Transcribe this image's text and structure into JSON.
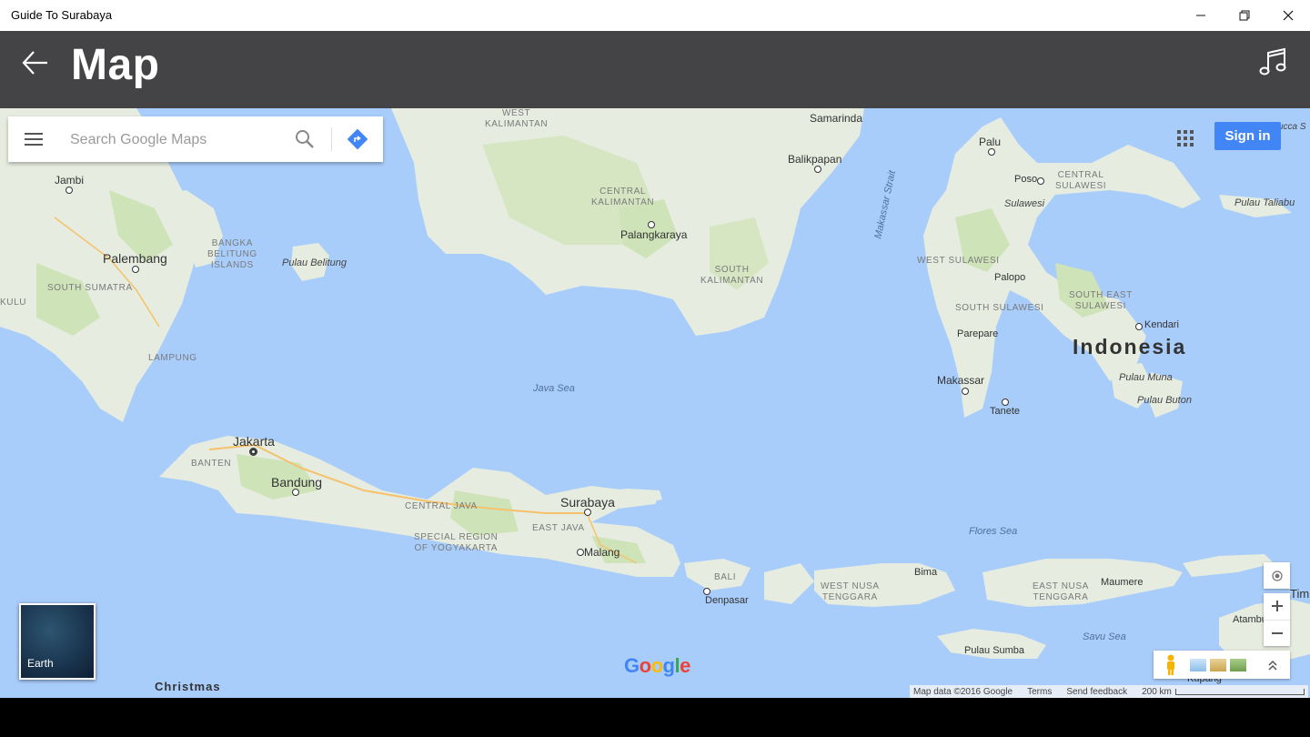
{
  "window": {
    "title": "Guide To Surabaya"
  },
  "header": {
    "title": "Map"
  },
  "search": {
    "placeholder": "Search Google Maps"
  },
  "signin": {
    "label": "Sign in"
  },
  "earth": {
    "label": "Earth"
  },
  "attribution": {
    "map_data": "Map data ©2016 Google",
    "terms": "Terms",
    "feedback": "Send feedback",
    "scale": "200 km"
  },
  "logo": {
    "text": "Google"
  },
  "labels": {
    "samarinda": "Samarinda",
    "balikpapan": "Balikpapan",
    "west_kalimantan": "WEST\nKALIMANTAN",
    "central_kalimantan": "CENTRAL\nKALIMANTAN",
    "palangkaraya": "Palangkaraya",
    "south_kalimantan": "SOUTH\nKALIMANTAN",
    "makassar_strait": "Makassar Strait",
    "palu": "Palu",
    "poso": "Poso",
    "central_sulawesi": "CENTRAL\nSULAWESI",
    "sulawesi": "Sulawesi",
    "pulau_taliabu": "Pulau Taliabu",
    "west_sulawesi": "WEST SULAWESI",
    "palopo": "Palopo",
    "south_east_sulawesi": "SOUTH EAST\nSULAWESI",
    "south_sulawesi": "SOUTH SULAWESI",
    "kendari": "Kendari",
    "parepare": "Parepare",
    "indonesia": "Indonesia",
    "pulau_muna": "Pulau Muna",
    "makassar": "Makassar",
    "pulau_buton": "Pulau Buton",
    "tanete": "Tanete",
    "jambi": "Jambi",
    "bangka_belitung": "BANGKA\nBELITUNG\nISLANDS",
    "pulau_belitung": "Pulau Belitung",
    "palembang": "Palembang",
    "kulu": "KULU",
    "south_sumatra": "SOUTH SUMATRA",
    "lampung": "LAMPUNG",
    "java_sea": "Java Sea",
    "jakarta": "Jakarta",
    "banten": "BANTEN",
    "bandung": "Bandung",
    "central_java": "CENTRAL JAVA",
    "surabaya": "Surabaya",
    "east_java": "EAST JAVA",
    "yogyakarta": "SPECIAL REGION\nOF YOGYAKARTA",
    "malang": "Malang",
    "flores_sea": "Flores Sea",
    "bima": "Bima",
    "bali": "BALI",
    "denpasar": "Denpasar",
    "west_nusa": "WEST NUSA\nTENGGARA",
    "east_nusa": "EAST NUSA\nTENGGARA",
    "maumere": "Maumere",
    "savu_sea": "Savu Sea",
    "pulau_sumba": "Pulau Sumba",
    "atambua": "Atambu",
    "kupang": "Kupang",
    "christmas": "Christmas",
    "ucca": "ucca S",
    "tim": "Tim"
  }
}
